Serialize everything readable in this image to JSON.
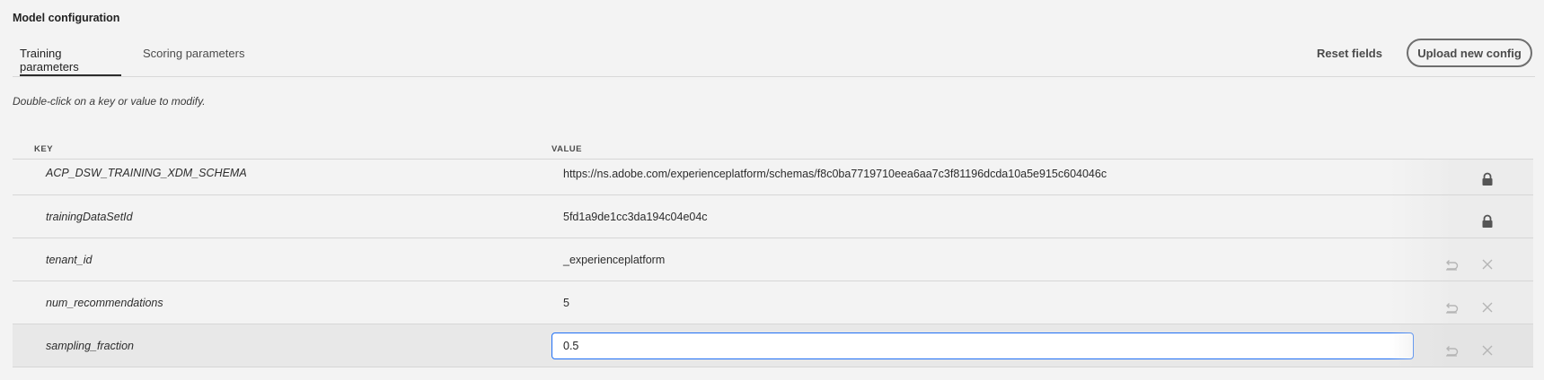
{
  "header": {
    "title": "Model configuration"
  },
  "tabs": [
    {
      "label": "Training parameters",
      "active": true
    },
    {
      "label": "Scoring parameters",
      "active": false
    }
  ],
  "actions": {
    "reset_label": "Reset fields",
    "upload_label": "Upload new config"
  },
  "hint": "Double-click on a key or value to modify.",
  "table": {
    "columns": {
      "key": "KEY",
      "value": "VALUE"
    },
    "rows": [
      {
        "key": "ACP_DSW_TRAINING_XDM_SCHEMA",
        "value": "https://ns.adobe.com/experienceplatform/schemas/f8c0ba7719710eea6aa7c3f81196dcda10a5e915c604046c",
        "locked": true
      },
      {
        "key": "trainingDataSetId",
        "value": "5fd1a9de1cc3da194c04e04c",
        "locked": true
      },
      {
        "key": "tenant_id",
        "value": "_experienceplatform",
        "locked": false
      },
      {
        "key": "num_recommendations",
        "value": "5",
        "locked": false
      },
      {
        "key": "sampling_fraction",
        "value": "0.5",
        "locked": false,
        "editing": true
      }
    ]
  },
  "icons": {
    "lock": "lock-icon",
    "revert": "undo-icon",
    "remove": "close-icon"
  },
  "colors": {
    "accent": "#1f6ff5",
    "background": "#f3f3f3",
    "icon": "#555555",
    "icon_muted": "#b5b5b5"
  }
}
